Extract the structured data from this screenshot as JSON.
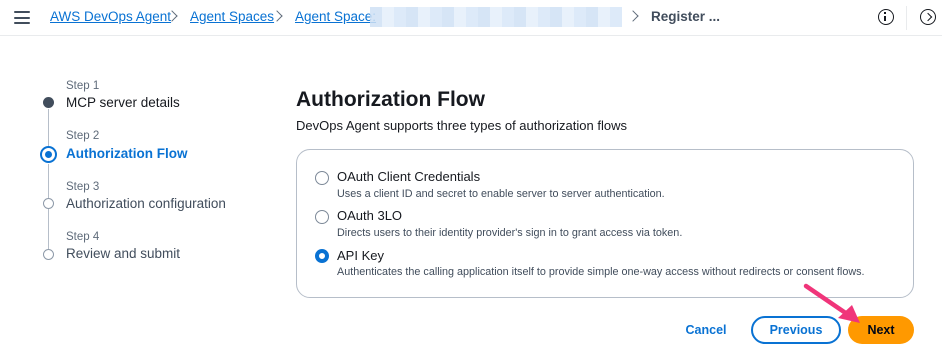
{
  "breadcrumbs": {
    "home": "AWS DevOps Agent",
    "spaces": "Agent Spaces",
    "space": "Agent Space:",
    "current": "Register ..."
  },
  "steps": [
    {
      "label": "Step 1",
      "title": "MCP server details",
      "state": "completed"
    },
    {
      "label": "Step 2",
      "title": "Authorization Flow",
      "state": "active"
    },
    {
      "label": "Step 3",
      "title": "Authorization configuration",
      "state": "pending"
    },
    {
      "label": "Step 4",
      "title": "Review and submit",
      "state": "pending"
    }
  ],
  "main": {
    "title": "Authorization Flow",
    "description": "DevOps Agent supports three types of authorization flows",
    "options": [
      {
        "label": "OAuth Client Credentials",
        "description": "Uses a client ID and secret to enable server to server authentication.",
        "selected": false
      },
      {
        "label": "OAuth 3LO",
        "description": "Directs users to their identity provider's sign in to grant access via token.",
        "selected": false
      },
      {
        "label": "API Key",
        "description": "Authenticates the calling application itself to provide simple one-way access without redirects or consent flows.",
        "selected": true
      }
    ]
  },
  "actions": {
    "cancel": "Cancel",
    "previous": "Previous",
    "next": "Next"
  },
  "icons": {
    "menu": "hamburger-menu-icon",
    "info": "info-icon",
    "feedback": "feedback-icon",
    "annotation": "pink-arrow-icon"
  },
  "colors": {
    "link": "#0972d3",
    "primary_button": "#ff9900",
    "annotation_arrow": "#f0357a"
  }
}
